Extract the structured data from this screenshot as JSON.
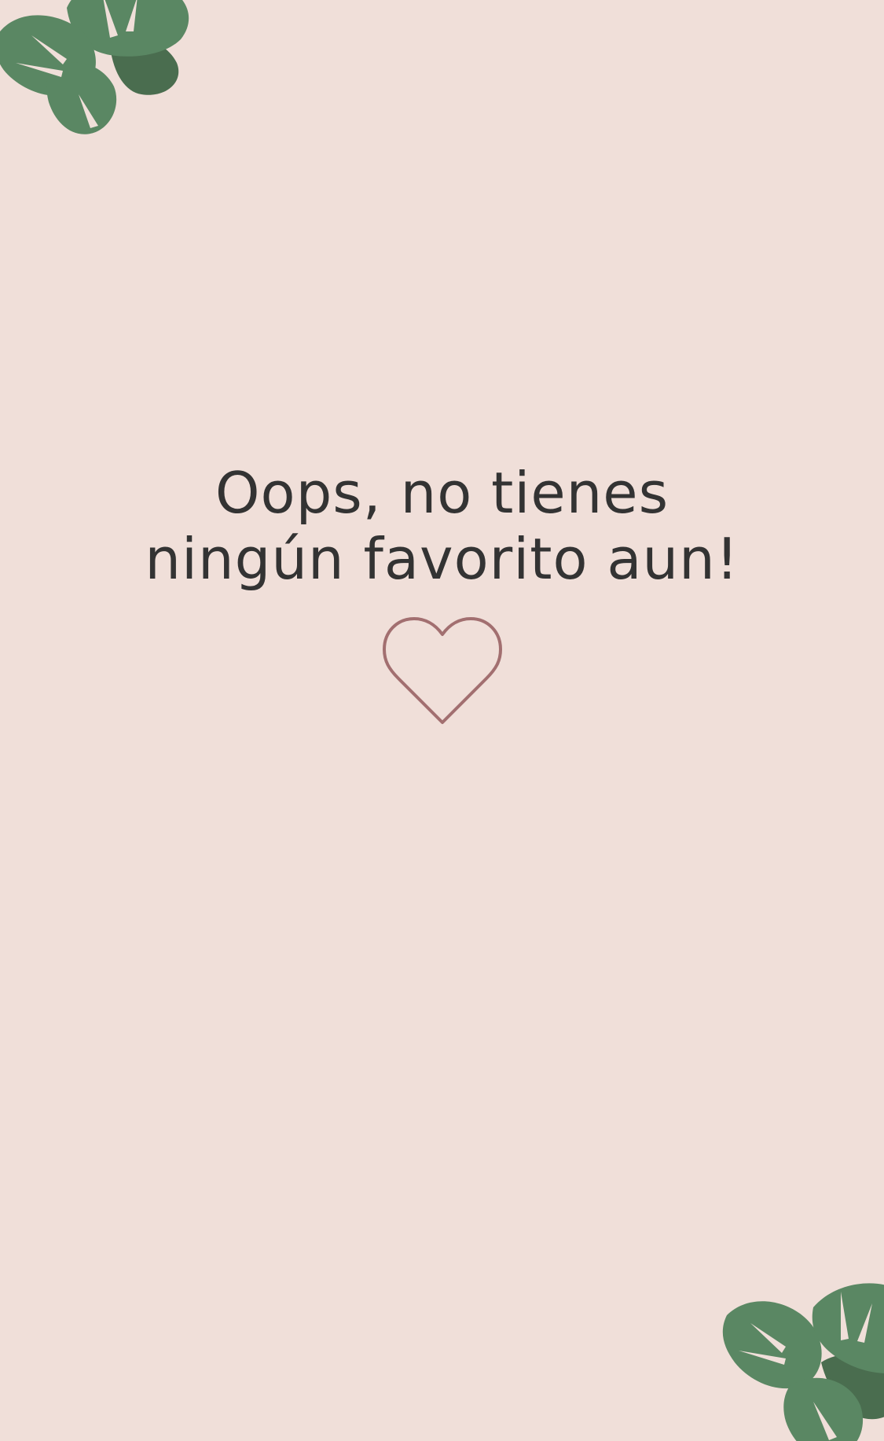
{
  "message": {
    "line1": "Oops, no tienes",
    "line2": "ningún favorito aun!"
  },
  "icons": {
    "empty_favorites": "heart-outline-icon",
    "decoration_top": "monstera-leaf-icon",
    "decoration_bottom": "monstera-leaf-icon"
  },
  "colors": {
    "background": "#f0dfd9",
    "text": "#333333",
    "heart_stroke": "#a26f70",
    "leaf": "#5a8763",
    "leaf_shadow": "#4a6d4f"
  }
}
